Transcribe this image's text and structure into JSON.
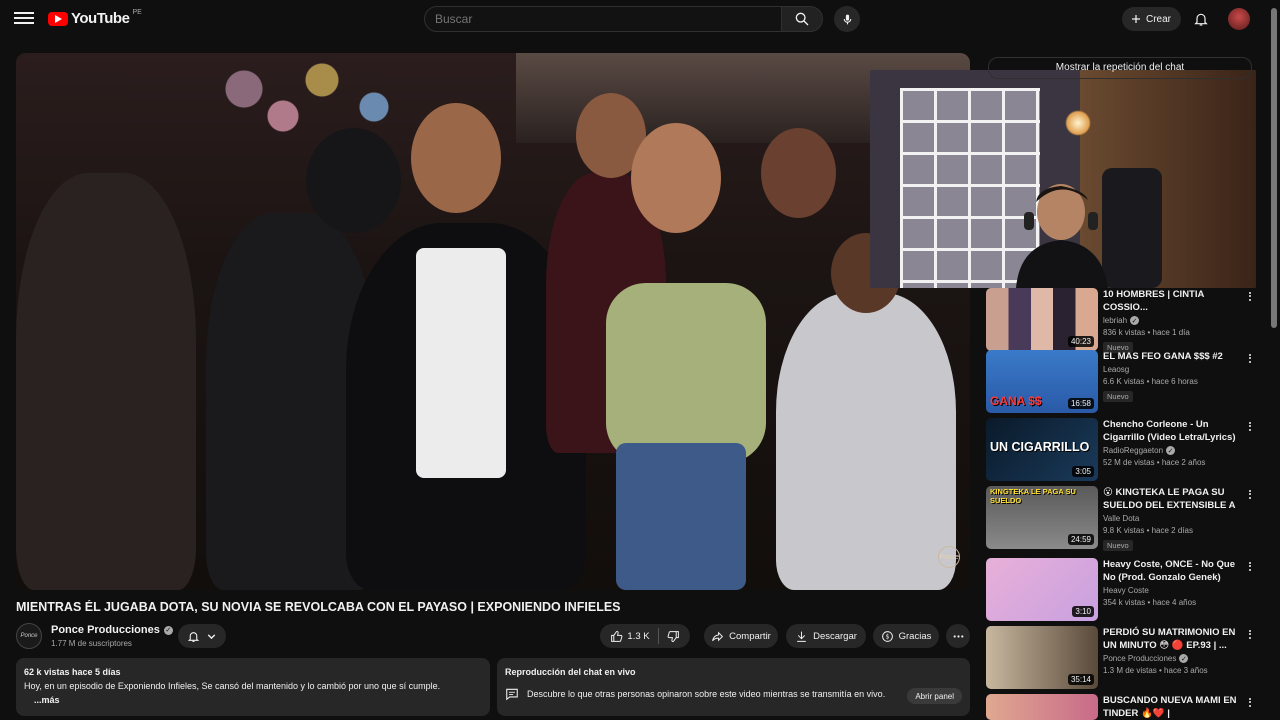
{
  "header": {
    "logo_text": "YouTube",
    "country": "PE",
    "search_placeholder": "Buscar",
    "create_label": "Crear"
  },
  "video": {
    "title": "MIENTRAS ÉL JUGABA DOTA, SU NOVIA SE REVOLCABA CON EL PAYASO | EXPONIENDO INFIELES",
    "watermark": "Ponce"
  },
  "channel": {
    "name": "Ponce Producciones",
    "subscribers": "1.77 M de suscriptores",
    "avatar_text": "Ponce"
  },
  "actions": {
    "likes": "1.3 K",
    "share": "Compartir",
    "download": "Descargar",
    "thanks": "Gracias"
  },
  "description": {
    "meta": "62 k vistas  hace 5 días",
    "text": "Hoy, en un episodio  de Exponiendo Infieles, Se cansó del mantenido y lo cambió por uno que sí cumple.",
    "more": "...más"
  },
  "chat_replay": {
    "top_button": "Mostrar la repetición del chat",
    "heading": "Reproducción del chat en vivo",
    "text": "Descubre lo que otras personas opinaron sobre este video mientras se transmitía en vivo.",
    "open_panel": "Abrir panel"
  },
  "recommendations": [
    {
      "title": "10 HOMBRES | CINTIA COSSIO...",
      "channel": "lebriah",
      "verified": true,
      "meta": "836 k vistas • hace 1 día",
      "badge": "Nuevo",
      "duration": "40:23",
      "thumb_text": ""
    },
    {
      "title": "EL MAS FEO GANA $$$ #2",
      "channel": "Leaosg",
      "verified": false,
      "meta": "6.6 K vistas • hace 6 horas",
      "badge": "Nuevo",
      "duration": "16:58",
      "thumb_text": "GANA $$"
    },
    {
      "title": "Chencho Corleone - Un Cigarrillo (Video Letra/Lyrics)",
      "channel": "RadioReggaeton",
      "verified": true,
      "meta": "52 M de vistas • hace 2 años",
      "badge": "",
      "duration": "3:05",
      "thumb_text": "UN CIGARRILLO"
    },
    {
      "title": "😮 KINGTEKA LE PAGA SU SUELDO DEL EXTENSIBLE A ...",
      "channel": "Valle Dota",
      "verified": false,
      "meta": "9.8 K vistas • hace 2 días",
      "badge": "Nuevo",
      "duration": "24:59",
      "thumb_text": "KINGTEKA LE PAGA SU SUELDO"
    },
    {
      "title": "Heavy Coste, ONCE - No Que No (Prod. Gonzalo Genek)",
      "channel": "Heavy Coste",
      "verified": false,
      "meta": "354 k vistas • hace 4 años",
      "badge": "",
      "duration": "3:10",
      "thumb_text": ""
    },
    {
      "title": "PERDIÓ SU MATRIMONIO EN UN MINUTO 😳 🔴 EP.93 | ...",
      "channel": "Ponce Producciones",
      "verified": true,
      "meta": "1.3 M de vistas • hace 3 años",
      "badge": "",
      "duration": "35:14",
      "thumb_text": ""
    },
    {
      "title": "BUSCANDO NUEVA MAMI EN TINDER 🔥❤️ | SACHAUZUMAKI",
      "channel": "",
      "verified": false,
      "meta": "",
      "badge": "",
      "duration": "",
      "thumb_text": ""
    }
  ],
  "colors": {
    "background": "#0f0f0f",
    "surface": "#272727",
    "brand_red": "#ff0000",
    "text_secondary": "#aaaaaa"
  }
}
